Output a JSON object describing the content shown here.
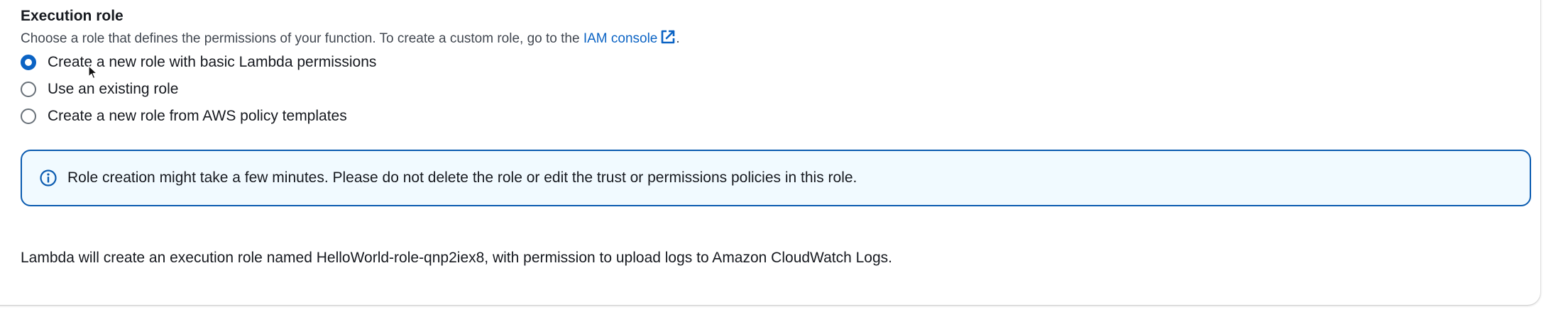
{
  "execution_role": {
    "title": "Execution role",
    "description_prefix": "Choose a role that defines the permissions of your function. To create a custom role, go to the ",
    "iam_link": "IAM console",
    "description_suffix": ".",
    "external_icon": "external-link-icon",
    "options": [
      {
        "label": "Create a new role with basic Lambda permissions",
        "selected": true
      },
      {
        "label": "Use an existing role",
        "selected": false
      },
      {
        "label": "Create a new role from AWS policy templates",
        "selected": false
      }
    ],
    "info_alert": {
      "icon": "info-icon",
      "text": "Role creation might take a few minutes. Please do not delete the role or edit the trust or permissions policies in this role."
    },
    "role_note": "Lambda will create an execution role named HelloWorld-role-qnp2iex8, with permission to upload logs to Amazon CloudWatch Logs."
  },
  "colors": {
    "accent": "#0b63c4",
    "alert_border": "#0a5bb0",
    "alert_background": "#f1faff"
  }
}
